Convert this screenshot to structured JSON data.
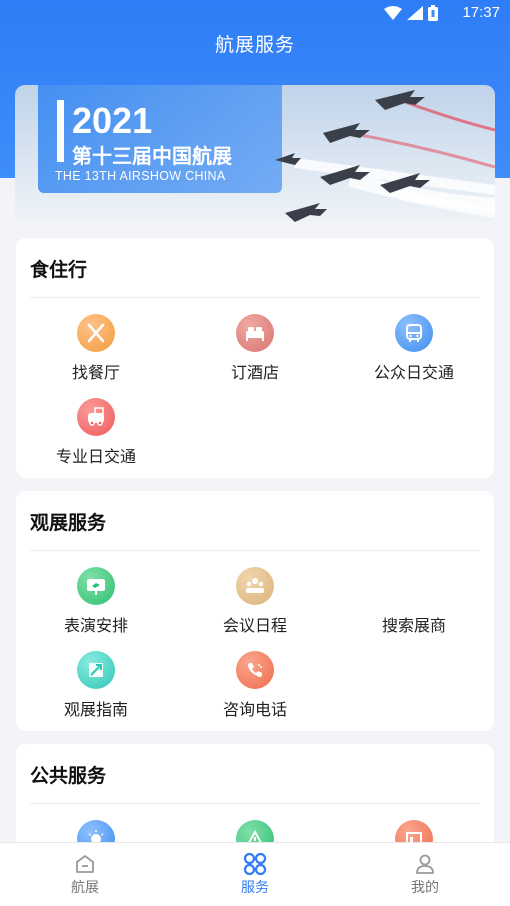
{
  "status_bar": {
    "time": "17:37"
  },
  "header": {
    "title": "航展服务"
  },
  "banner": {
    "year": "2021",
    "title_cn": "第十三届中国航展",
    "title_en": "THE 13TH AIRSHOW CHINA"
  },
  "sections": [
    {
      "title": "食住行",
      "items": [
        {
          "label": "找餐厅",
          "icon": "restaurant-icon",
          "color": "#f39a3d"
        },
        {
          "label": "订酒店",
          "icon": "hotel-bed-icon",
          "color": "#d9736f"
        },
        {
          "label": "公众日交通",
          "icon": "bus-icon",
          "color": "#3d8df1"
        },
        {
          "label": "专业日交通",
          "icon": "shuttle-icon",
          "color": "#ef5a5a"
        }
      ]
    },
    {
      "title": "观展服务",
      "items": [
        {
          "label": "表演安排",
          "icon": "show-screen-icon",
          "color": "#2fbf71"
        },
        {
          "label": "会议日程",
          "icon": "meeting-icon",
          "color": "#d9b27a"
        },
        {
          "label": "搜索展商",
          "icon": "",
          "color": ""
        },
        {
          "label": "观展指南",
          "icon": "guide-map-icon",
          "color": "#2fc6b5"
        },
        {
          "label": "咨询电话",
          "icon": "phone-icon",
          "color": "#ef6a4a"
        }
      ]
    },
    {
      "title": "公共服务",
      "items": [
        {
          "label": "",
          "icon": "lightbulb-icon",
          "color": "#3d8df1"
        },
        {
          "label": "",
          "icon": "warning-icon",
          "color": "#2fbf71"
        },
        {
          "label": "",
          "icon": "notice-board-icon",
          "color": "#ef6a4a"
        }
      ]
    }
  ],
  "tabs": [
    {
      "label": "航展",
      "active": false
    },
    {
      "label": "服务",
      "active": true
    },
    {
      "label": "我的",
      "active": false
    }
  ]
}
